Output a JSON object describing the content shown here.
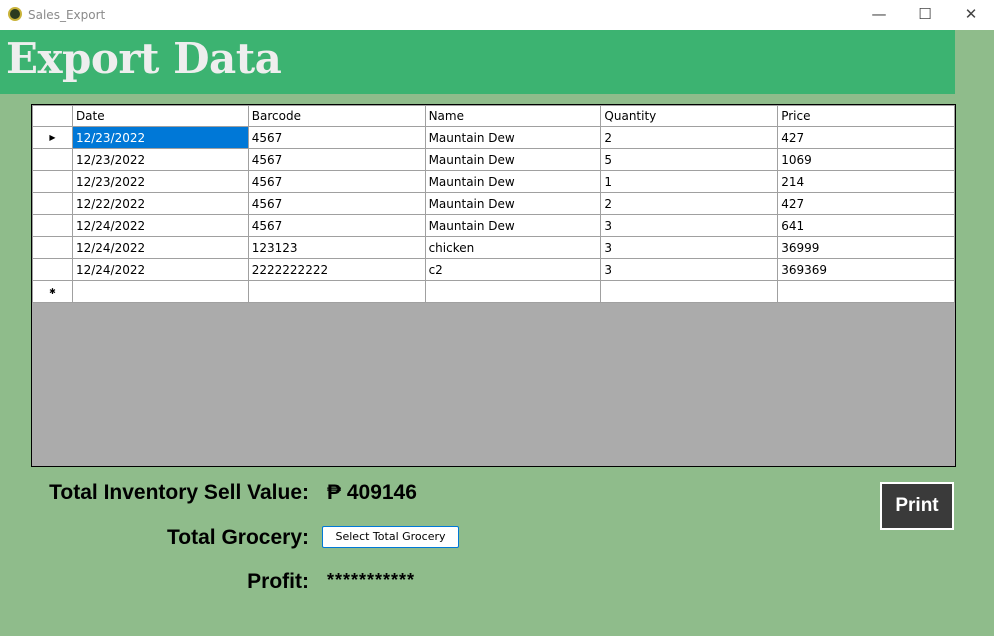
{
  "window": {
    "title": "Sales_Export",
    "minimize_glyph": "—",
    "maximize_glyph": "☐",
    "close_glyph": "✕"
  },
  "header": {
    "title": "Export Data"
  },
  "grid": {
    "columns": [
      "Date",
      "Barcode",
      "Name",
      "Quantity",
      "Price"
    ],
    "rows": [
      [
        "12/23/2022",
        "4567",
        "Mauntain Dew",
        "2",
        "427"
      ],
      [
        "12/23/2022",
        "4567",
        "Mauntain Dew",
        "5",
        "1069"
      ],
      [
        "12/23/2022",
        "4567",
        "Mauntain Dew",
        "1",
        "214"
      ],
      [
        "12/22/2022",
        "4567",
        "Mauntain Dew",
        "2",
        "427"
      ],
      [
        "12/24/2022",
        "4567",
        "Mauntain Dew",
        "3",
        "641"
      ],
      [
        "12/24/2022",
        "123123",
        "chicken",
        "3",
        "36999"
      ],
      [
        "12/24/2022",
        "2222222222",
        "c2",
        "3",
        "369369"
      ]
    ],
    "current_row_marker": "▶",
    "new_row_marker": "✱"
  },
  "summary": {
    "total_label": "Total Inventory Sell Value:",
    "total_value": "₱ 409146",
    "grocery_label": "Total Grocery:",
    "grocery_button": "Select Total Grocery",
    "profit_label": "Profit:",
    "profit_value": "***********"
  },
  "actions": {
    "print_label": "Print"
  },
  "colors": {
    "background": "#8fbc8b",
    "banner": "#3cb371",
    "selection": "#0078d7",
    "print_button": "#3a3a3a"
  }
}
